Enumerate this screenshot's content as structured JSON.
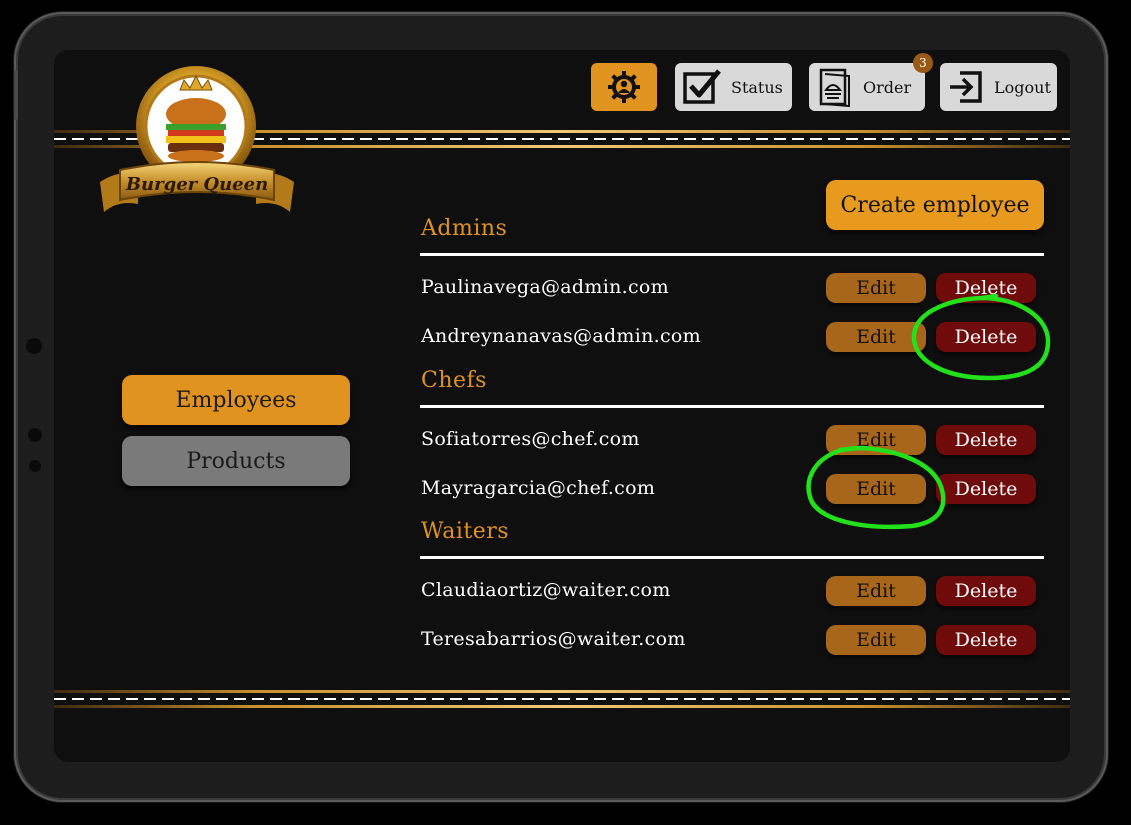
{
  "toolbar": {
    "settings_icon": "gear-person-icon",
    "status_label": "Status",
    "order_label": "Order",
    "order_badge": "3",
    "logout_label": "Logout"
  },
  "logo": {
    "text": "Burger Queen"
  },
  "nav": {
    "employees_label": "Employees",
    "products_label": "Products"
  },
  "create_label": "Create employee",
  "sections": [
    {
      "title": "Admins",
      "emails": [
        "Paulinavega@admin.com",
        "Andreynanavas@admin.com"
      ]
    },
    {
      "title": "Chefs",
      "emails": [
        "Sofiatorres@chef.com",
        "Mayragarcia@chef.com"
      ]
    },
    {
      "title": "Waiters",
      "emails": [
        "Claudiaortiz@waiter.com",
        "Teresabarrios@waiter.com"
      ]
    }
  ],
  "row_actions": {
    "edit_label": "Edit",
    "delete_label": "Delete"
  },
  "colors": {
    "accent": "#e0931f",
    "edit": "#a7661a",
    "delete": "#6f0b0b",
    "annotation": "#22e01a"
  }
}
